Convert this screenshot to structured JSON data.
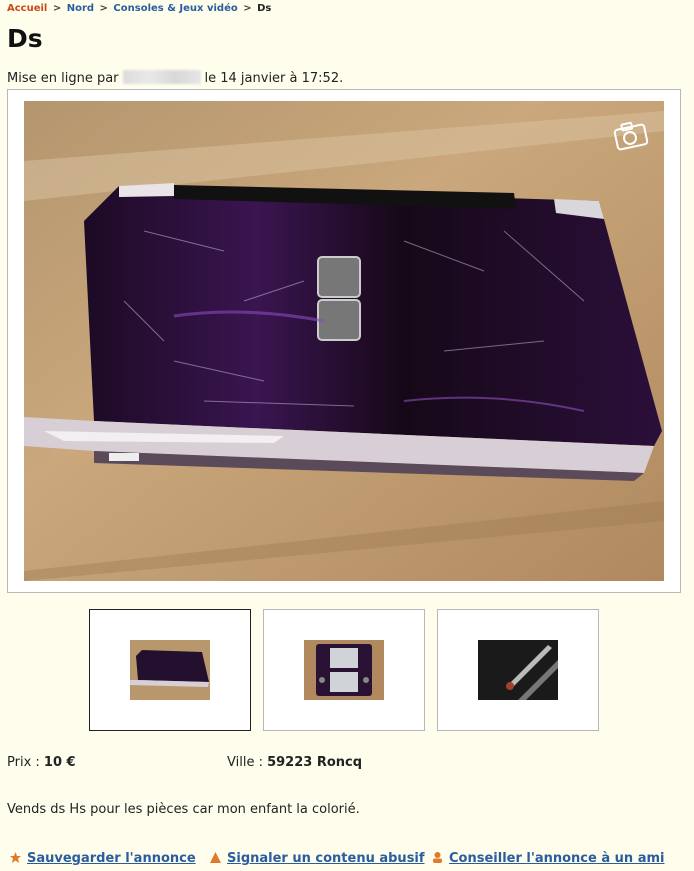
{
  "breadcrumb": {
    "home": "Accueil",
    "sep": ">",
    "region": "Nord",
    "category": "Consoles & Jeux vidéo",
    "current": "Ds"
  },
  "title": "Ds",
  "posted": {
    "prefix": "Mise en ligne par",
    "date": "le 14 janvier à 17:52."
  },
  "gallery": {
    "main_image": "scratched-purple-nintendo-ds-photo",
    "thumbnails": [
      "ds-closed-photo",
      "ds-open-screens-photo",
      "ds-closeup-photo"
    ],
    "selected_index": 0
  },
  "details": {
    "price_label": "Prix :",
    "price_value": "10 €",
    "city_label": "Ville :",
    "city_value": "59223 Roncq"
  },
  "description": "Vends ds Hs pour les pièces car mon enfant la colorié.",
  "actions": {
    "save": "Sauvegarder l'annonce",
    "report": "Signaler un contenu abusif",
    "share": "Conseiller l'annonce à un ami"
  },
  "colors": {
    "background": "#fffdeb",
    "link": "#2a5d9f",
    "home_link": "#c94a1b",
    "action_icon": "#e07a2a"
  }
}
